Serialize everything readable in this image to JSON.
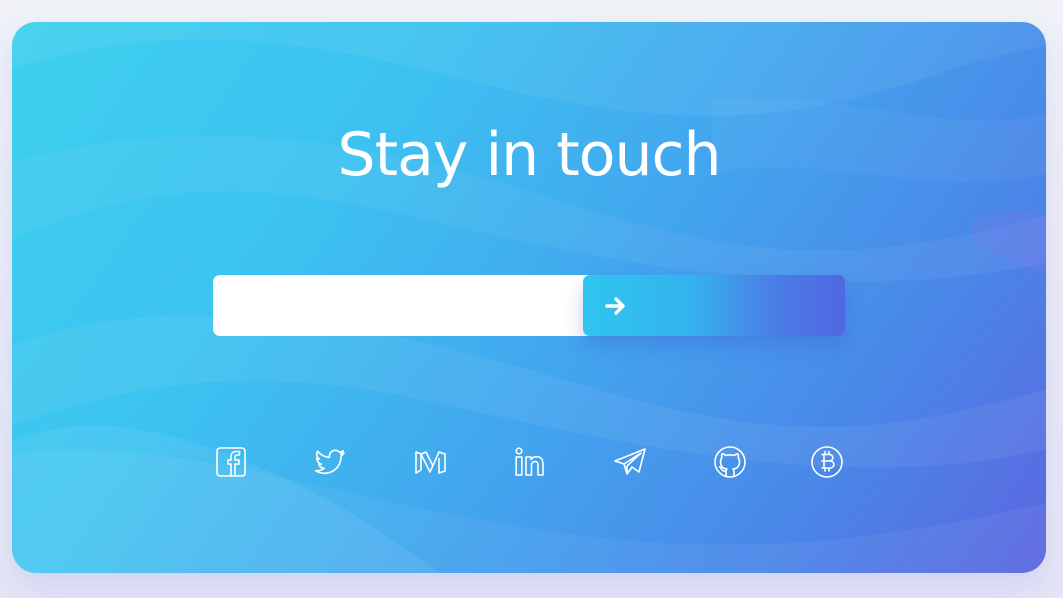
{
  "newsletter": {
    "title": "Stay in touch",
    "email_value": "",
    "email_placeholder": "",
    "submit_icon": "arrow-right-icon"
  },
  "socials": [
    {
      "name": "facebook",
      "icon": "facebook-icon"
    },
    {
      "name": "twitter",
      "icon": "twitter-icon"
    },
    {
      "name": "medium",
      "icon": "medium-icon"
    },
    {
      "name": "linkedin",
      "icon": "linkedin-icon"
    },
    {
      "name": "telegram",
      "icon": "telegram-icon"
    },
    {
      "name": "github",
      "icon": "github-icon"
    },
    {
      "name": "bitcoin",
      "icon": "bitcoin-icon"
    }
  ],
  "colors": {
    "card_gradient_start": "#3fd0ef",
    "card_gradient_end": "#5c66e0",
    "button_gradient_start": "#2ec5ef",
    "button_gradient_end": "#5068e2",
    "text": "#ffffff",
    "page_background": "#eef0f7"
  }
}
